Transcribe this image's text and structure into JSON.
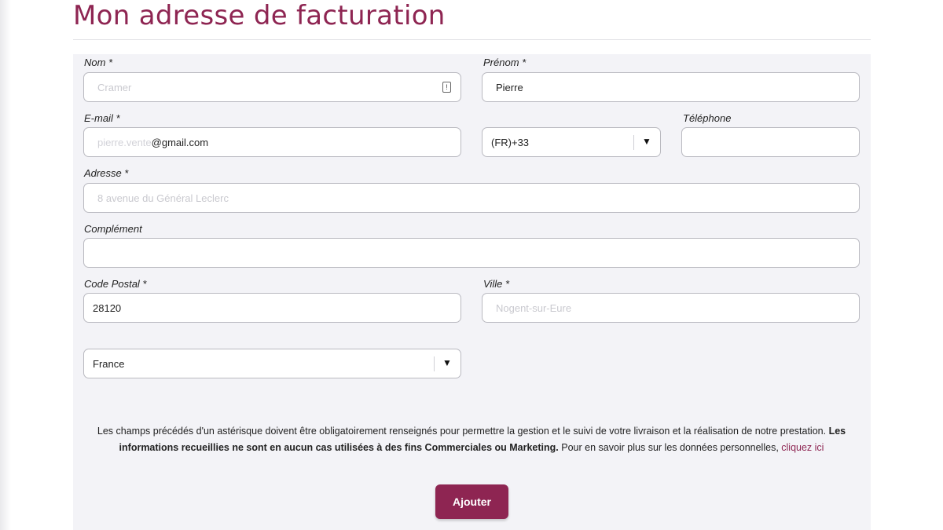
{
  "page": {
    "title": "Mon adresse de facturation"
  },
  "form": {
    "nom": {
      "label": "Nom *",
      "value": "Cramer"
    },
    "prenom": {
      "label": "Prénom *",
      "value": "Pierre"
    },
    "email": {
      "label": "E-mail *",
      "value_blurred": "pierre.vente",
      "value_visible": "@gmail.com"
    },
    "phone_code": {
      "value": "(FR)+33"
    },
    "telephone": {
      "label": "Téléphone",
      "value": ""
    },
    "adresse": {
      "label": "Adresse *",
      "value": "8 avenue du Général Leclerc"
    },
    "complement": {
      "label": "Complément",
      "value": ""
    },
    "code_postal": {
      "label": "Code Postal *",
      "value": "28120"
    },
    "ville": {
      "label": "Ville *",
      "value": "Nogent-sur-Eure"
    },
    "pays": {
      "value": "France"
    }
  },
  "notice": {
    "text_start": "Les champs précédés d'un astérisque doivent être obligatoirement renseignés pour permettre la gestion et le suivi de votre livraison et la réalisation de notre prestation. ",
    "text_bold": "Les informations recueillies ne sont en aucun cas utilisées à des fins Commerciales ou Marketing.",
    "text_end": " Pour en savoir plus sur les données personnelles, ",
    "link": "cliquez ici"
  },
  "actions": {
    "submit_label": "Ajouter"
  },
  "icons": {
    "password_field": "key-icon",
    "dropdown": "caret-down-icon"
  },
  "colors": {
    "brand": "#8e2552",
    "panel": "#f3f3f7",
    "border": "#b9b9c0"
  }
}
